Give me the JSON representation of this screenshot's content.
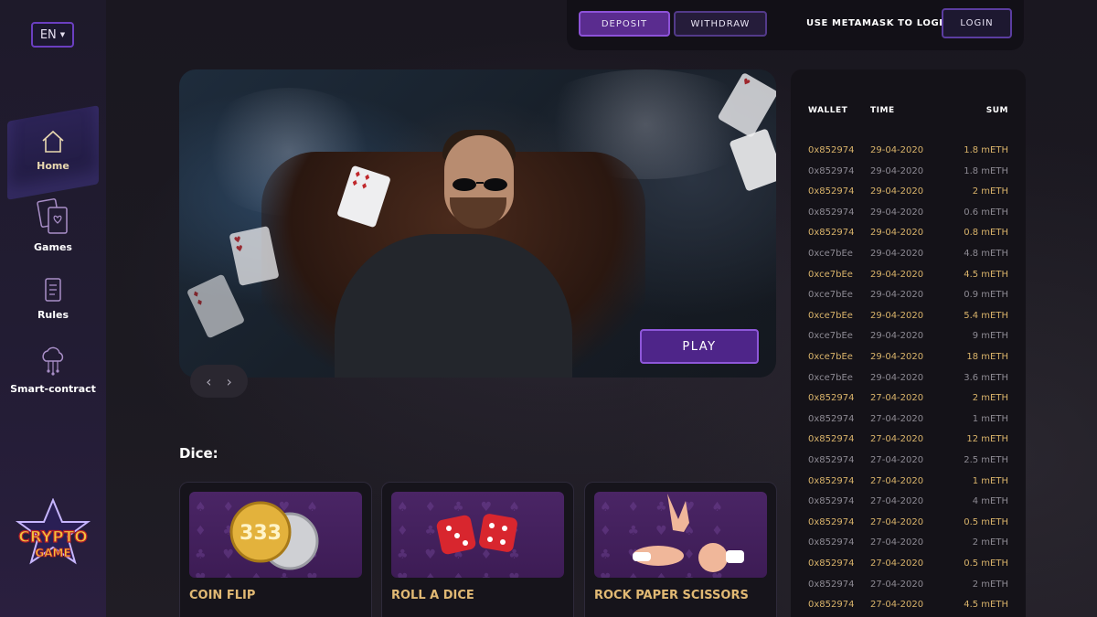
{
  "sidebar": {
    "lang": "EN",
    "items": [
      {
        "label": "Home",
        "icon": "house-icon",
        "active": true
      },
      {
        "label": "Games",
        "icon": "cards-icon",
        "active": false
      },
      {
        "label": "Rules",
        "icon": "scroll-icon",
        "active": false
      },
      {
        "label": "Smart-contract",
        "icon": "cloud-network-icon",
        "active": false
      }
    ],
    "logo": {
      "line1": "CRYPTO",
      "line2": "GAME"
    }
  },
  "topbar": {
    "deposit_label": "DEPOSIT",
    "withdraw_label": "WITHDRAW",
    "metamask_text": "USE METAMASK TO LOGIN",
    "login_label": "LOGIN"
  },
  "hero": {
    "play_label": "PLAY",
    "prev": "‹",
    "next": "›"
  },
  "dice_section": {
    "title": "Dice:",
    "games": [
      {
        "label": "COIN FLIP",
        "coin_text": "333"
      },
      {
        "label": "ROLL A DICE"
      },
      {
        "label": "ROCK PAPER SCISSORS"
      }
    ]
  },
  "transactions": {
    "headers": {
      "wallet": "WALLET",
      "time": "TIME",
      "sum": "SUM"
    },
    "rows": [
      {
        "wallet": "0x852974",
        "time": "29-04-2020",
        "sum": "1.8 mETH",
        "highlight": true
      },
      {
        "wallet": "0x852974",
        "time": "29-04-2020",
        "sum": "1.8 mETH",
        "highlight": false
      },
      {
        "wallet": "0x852974",
        "time": "29-04-2020",
        "sum": "2 mETH",
        "highlight": true
      },
      {
        "wallet": "0x852974",
        "time": "29-04-2020",
        "sum": "0.6 mETH",
        "highlight": false
      },
      {
        "wallet": "0x852974",
        "time": "29-04-2020",
        "sum": "0.8 mETH",
        "highlight": true
      },
      {
        "wallet": "0xce7bEe",
        "time": "29-04-2020",
        "sum": "4.8 mETH",
        "highlight": false
      },
      {
        "wallet": "0xce7bEe",
        "time": "29-04-2020",
        "sum": "4.5 mETH",
        "highlight": true
      },
      {
        "wallet": "0xce7bEe",
        "time": "29-04-2020",
        "sum": "0.9 mETH",
        "highlight": false
      },
      {
        "wallet": "0xce7bEe",
        "time": "29-04-2020",
        "sum": "5.4 mETH",
        "highlight": true
      },
      {
        "wallet": "0xce7bEe",
        "time": "29-04-2020",
        "sum": "9 mETH",
        "highlight": false
      },
      {
        "wallet": "0xce7bEe",
        "time": "29-04-2020",
        "sum": "18 mETH",
        "highlight": true
      },
      {
        "wallet": "0xce7bEe",
        "time": "29-04-2020",
        "sum": "3.6 mETH",
        "highlight": false
      },
      {
        "wallet": "0x852974",
        "time": "27-04-2020",
        "sum": "2 mETH",
        "highlight": true
      },
      {
        "wallet": "0x852974",
        "time": "27-04-2020",
        "sum": "1 mETH",
        "highlight": false
      },
      {
        "wallet": "0x852974",
        "time": "27-04-2020",
        "sum": "12 mETH",
        "highlight": true
      },
      {
        "wallet": "0x852974",
        "time": "27-04-2020",
        "sum": "2.5 mETH",
        "highlight": false
      },
      {
        "wallet": "0x852974",
        "time": "27-04-2020",
        "sum": "1 mETH",
        "highlight": true
      },
      {
        "wallet": "0x852974",
        "time": "27-04-2020",
        "sum": "4 mETH",
        "highlight": false
      },
      {
        "wallet": "0x852974",
        "time": "27-04-2020",
        "sum": "0.5 mETH",
        "highlight": true
      },
      {
        "wallet": "0x852974",
        "time": "27-04-2020",
        "sum": "2 mETH",
        "highlight": false
      },
      {
        "wallet": "0x852974",
        "time": "27-04-2020",
        "sum": "0.5 mETH",
        "highlight": true
      },
      {
        "wallet": "0x852974",
        "time": "27-04-2020",
        "sum": "2 mETH",
        "highlight": false
      },
      {
        "wallet": "0x852974",
        "time": "27-04-2020",
        "sum": "4.5 mETH",
        "highlight": true
      }
    ]
  },
  "colors": {
    "accent_purple": "#5a2c8f",
    "gold_text": "#d9b36a",
    "muted_text": "#8d8a93"
  }
}
